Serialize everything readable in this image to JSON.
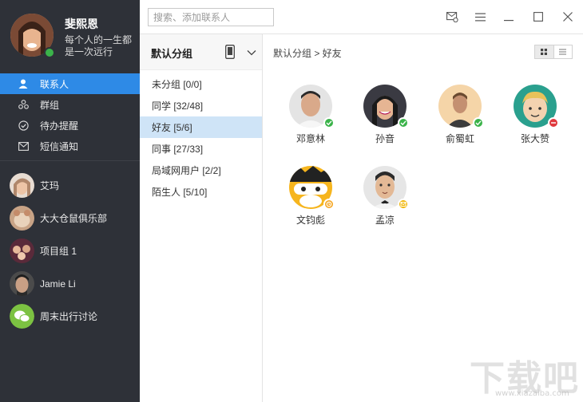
{
  "profile": {
    "name": "斐熙恩",
    "motto": "每个人的一生都是一次远行",
    "status_color": "#3bb34a"
  },
  "nav": [
    {
      "label": "联系人",
      "icon": "user-icon",
      "active": true
    },
    {
      "label": "群组",
      "icon": "group-icon",
      "active": false
    },
    {
      "label": "待办提醒",
      "icon": "check-circle-icon",
      "active": false
    },
    {
      "label": "短信通知",
      "icon": "mail-icon",
      "active": false
    }
  ],
  "recent": [
    {
      "label": "艾玛"
    },
    {
      "label": "大大仓鼠俱乐部"
    },
    {
      "label": "项目组 1"
    },
    {
      "label": "Jamie Li"
    },
    {
      "label": "周末出行讨论"
    }
  ],
  "search": {
    "placeholder": "搜索、添加联系人"
  },
  "groups": {
    "title": "默认分组",
    "items": [
      {
        "label": "未分组 [0/0]",
        "active": false
      },
      {
        "label": "同学 [32/48]",
        "active": false
      },
      {
        "label": "好友 [5/6]",
        "active": true
      },
      {
        "label": "同事 [27/33]",
        "active": false
      },
      {
        "label": "局域网用户 [2/2]",
        "active": false
      },
      {
        "label": "陌生人 [5/10]",
        "active": false
      }
    ]
  },
  "breadcrumb": "默认分组 > 好友",
  "contacts": [
    {
      "name": "邓意林",
      "status": "online"
    },
    {
      "name": "孙音",
      "status": "online"
    },
    {
      "name": "俞蜀虹",
      "status": "online"
    },
    {
      "name": "张大赞",
      "status": "busy"
    },
    {
      "name": "文钧彪",
      "status": "away"
    },
    {
      "name": "孟凉",
      "status": "message"
    }
  ],
  "colors": {
    "accent": "#2e8ae6",
    "online": "#3bb34a",
    "busy": "#e0393e",
    "away": "#f5a623",
    "message": "#f0b400"
  },
  "watermark": {
    "text": "下载吧",
    "url": "www.xiazaiba.com"
  }
}
